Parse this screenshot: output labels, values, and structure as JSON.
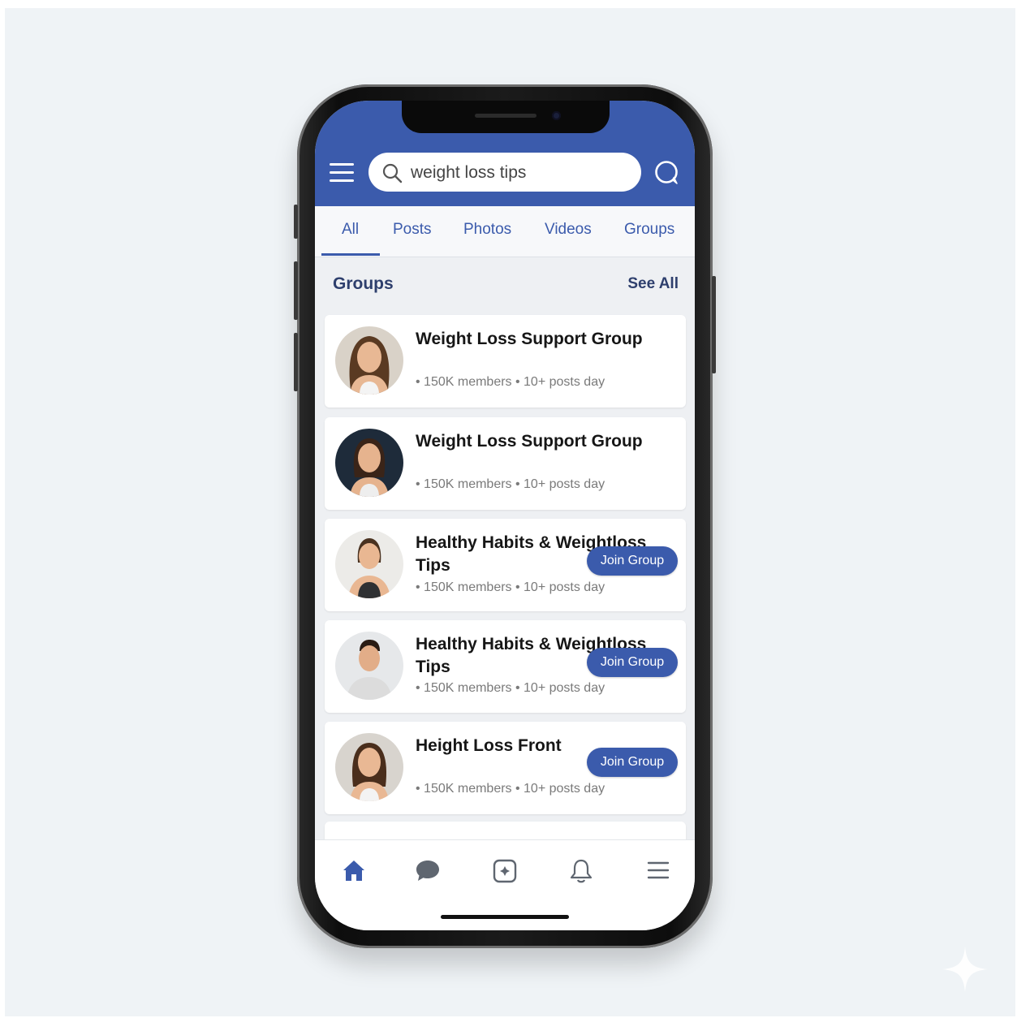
{
  "search": {
    "value": "weight loss tips"
  },
  "tabs": [
    {
      "label": "All",
      "active": true
    },
    {
      "label": "Posts"
    },
    {
      "label": "Photos"
    },
    {
      "label": "Videos"
    },
    {
      "label": "Groups"
    }
  ],
  "section": {
    "title": "Groups",
    "see_all": "See All"
  },
  "groups": [
    {
      "name": "Weight Loss Support Group",
      "meta": "• 150K members • 10+ posts day",
      "join": ""
    },
    {
      "name": "Weight Loss Support Group",
      "meta": "• 150K members • 10+ posts day",
      "join": ""
    },
    {
      "name": "Healthy Habits & Weightloss Tips",
      "meta": "• 150K members • 10+ posts day",
      "join": "Join Group"
    },
    {
      "name": "Healthy Habits & Weightloss Tips",
      "meta": "• 150K members • 10+ posts day",
      "join": "Join Group"
    },
    {
      "name": "Height Loss Front",
      "meta": "• 150K members • 10+ posts day",
      "join": "Join Group"
    }
  ],
  "bottom_nav": [
    "home-icon",
    "chat-icon",
    "add-icon",
    "bell-icon",
    "menu-icon"
  ],
  "colors": {
    "brand": "#3b5bac",
    "background": "#eef0f3"
  }
}
